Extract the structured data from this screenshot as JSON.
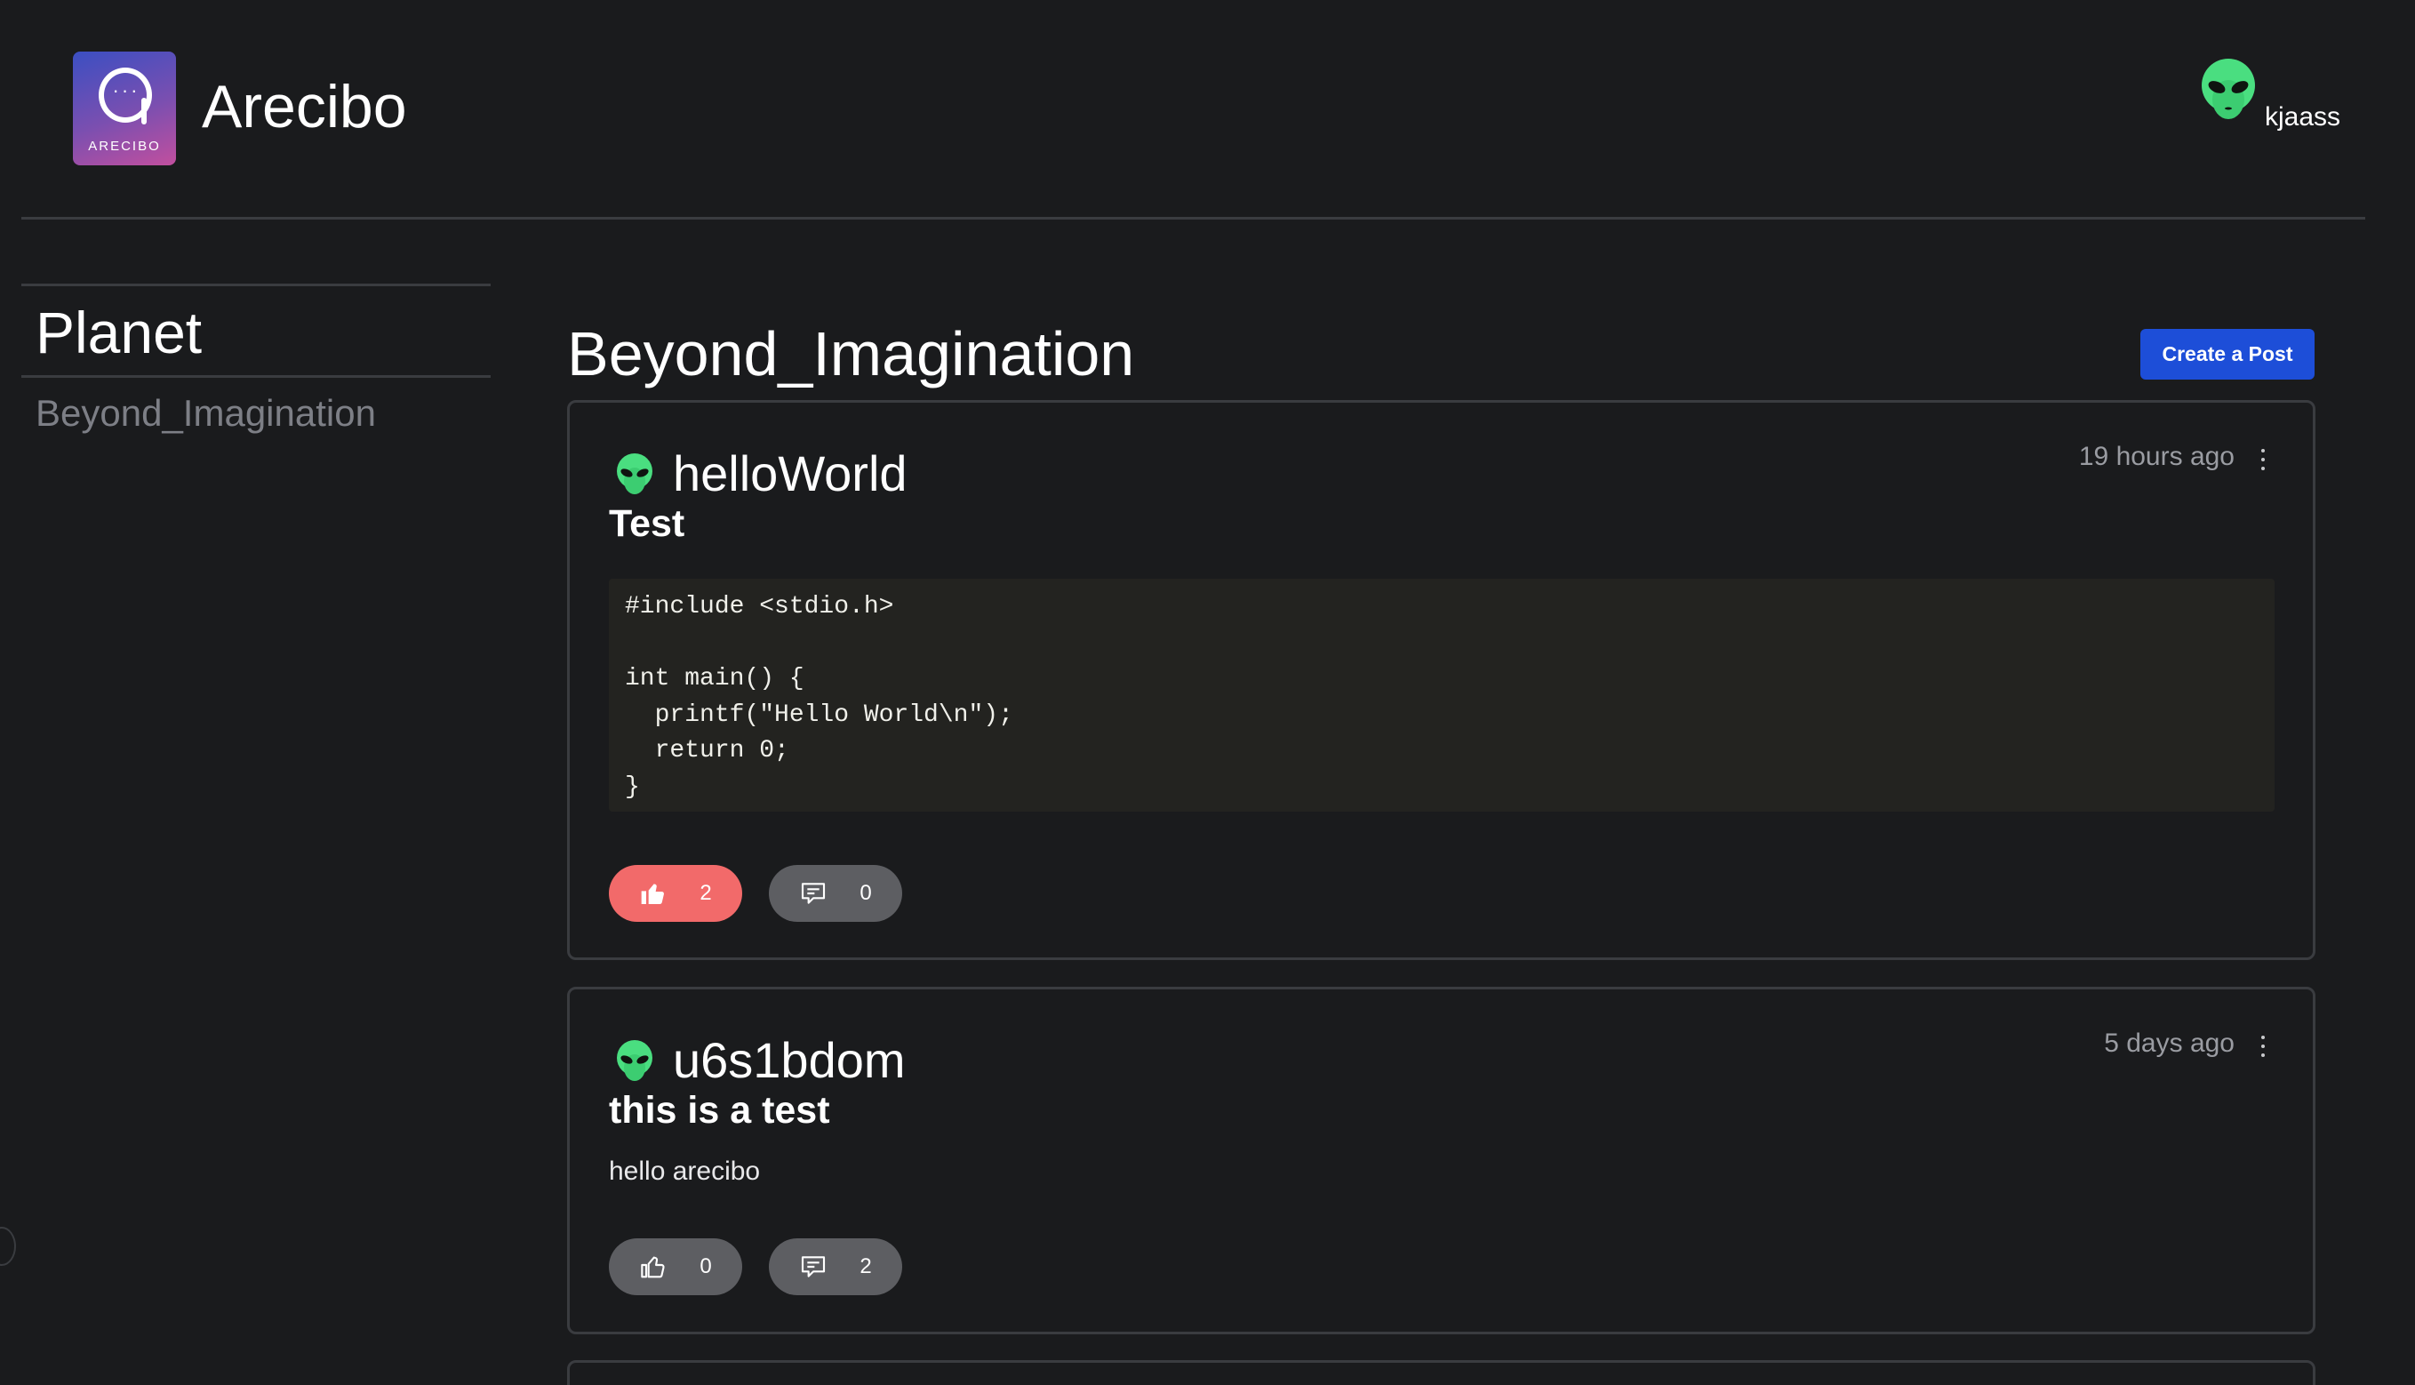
{
  "header": {
    "logo_text": "ARECIBO",
    "logo_dots": "···",
    "app_title": "Arecibo",
    "username": "kjaass"
  },
  "sidebar": {
    "section_title": "Planet",
    "items": [
      {
        "label": "Beyond_Imagination"
      }
    ]
  },
  "main": {
    "page_title": "Beyond_Imagination",
    "create_post_label": "Create a Post",
    "posts": [
      {
        "author": "helloWorld",
        "time": "19 hours ago",
        "title": "Test",
        "code": "#include <stdio.h>\n\nint main() {\n  printf(\"Hello World\\n\");\n  return 0;\n}",
        "likes": "2",
        "comments": "0",
        "liked": true
      },
      {
        "author": "u6s1bdom",
        "time": "5 days ago",
        "title": "this is a test",
        "body": "hello arecibo",
        "likes": "0",
        "comments": "2",
        "liked": false
      }
    ]
  },
  "icons": {
    "avatar": "alien-icon",
    "like": "thumbs-up-icon",
    "comment": "comment-icon",
    "menu": "kebab-menu-icon"
  },
  "colors": {
    "background": "#1a1b1d",
    "border": "#3a3c40",
    "accent": "#1d4ed8",
    "liked": "#f26a6a",
    "pill_grey": "#5d5e62",
    "alien_green": "#4ade80"
  }
}
